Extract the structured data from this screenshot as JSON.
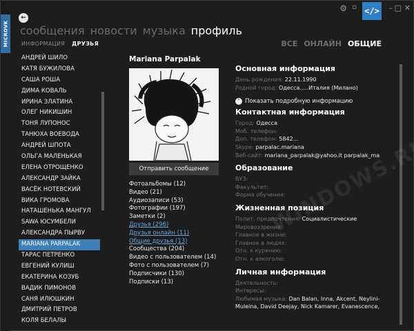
{
  "brand": {
    "label": "MICROVK"
  },
  "nav": {
    "items": [
      "сообщения",
      "новости",
      "музыка",
      "профиль"
    ]
  },
  "subnav": {
    "items": [
      "ИНФОРМАЦИЯ",
      "ДРУЗЬЯ"
    ]
  },
  "filters": {
    "items": [
      "ВСЕ",
      "ОНЛАЙН",
      "ОБЩИЕ"
    ]
  },
  "friends": [
    "АНДРЕЙ ШИЛО",
    "КАТЯ БУЖИЛОВА",
    "САША РОША",
    "ДИМА КОВАЛЬ",
    "ИРИНА ЗЛАТИНА",
    "ОЛЕГ НИКИШИН",
    "ТОНЯ ЛУПОНОС",
    "ТАНЮХА ВОЕВОДА",
    "АНДРЕЙ ШПОТА",
    "ОЛЬГА МАЛЕНЬКАЯ",
    "ЕЛЕНА ОТРОЩЕНКО",
    "АЛЕКСАНДР ЗАЙКА",
    "ВАСЁК НОТЕВСКИЙ",
    "ВИКА ГРОМОВА",
    "НАТАШЕНЬКА МАНГУЛ",
    "SAWA ЮСУМБЕЛИ",
    "АЛЕКСАНДРА ПЫРВУ",
    "MARIANA PARPALAK",
    "ТАРАС ПЕТРЕНКО",
    "ЕВГЕНИЙ КУЛИШ",
    "ЕКАТЕРИНА КОЗУБ",
    "ВАДИК ПИМОНОВ",
    "САНЯ ИЛЮШКИН",
    "ДМИТРИЙ ПЕТРОВ",
    "КОЛЯ БЕЛАЛЫ"
  ],
  "profile": {
    "name": "Mariana  Parpalak",
    "send_button": "Отправить сообщение",
    "links": [
      {
        "text": "Фотоальбомы (12)",
        "link": false
      },
      {
        "text": "Видео (21)",
        "link": false
      },
      {
        "text": "Аудиозаписи (53)",
        "link": false
      },
      {
        "text": "Фотографии (197)",
        "link": false
      },
      {
        "text": "Заметки (2)",
        "link": false
      },
      {
        "text": "Друзья (296)",
        "link": true
      },
      {
        "text": "Друзья онлайн (11)",
        "link": true
      },
      {
        "text": "Общие друзья (13)",
        "link": true
      },
      {
        "text": "Сообщества (204)",
        "link": false
      },
      {
        "text": "Видео с пользователем (14)",
        "link": false
      },
      {
        "text": "Фото с пользователем (7)",
        "link": false
      },
      {
        "text": "Подписчики (130)",
        "link": false
      },
      {
        "text": "Подписки (13)",
        "link": false
      }
    ]
  },
  "info": {
    "basic_title": "Основная информация",
    "basic": [
      {
        "k": "День рождения:",
        "v": "22.11.1990"
      },
      {
        "k": "Родной город:",
        "v": "Одесса.....Италия (Милано)"
      }
    ],
    "expand_label": "Показать подробную информацию",
    "contact_title": "Контактная информация",
    "contact": [
      {
        "k": "Город:",
        "v": "Одесса"
      },
      {
        "k": "Моб. телефон:",
        "v": ""
      },
      {
        "k": "Доп. телефон:",
        "v": "5842..."
      },
      {
        "k": "Skype:",
        "v": "parpalac.mariana"
      },
      {
        "k": "Веб-сайт:",
        "v": "mariana_parpalak@yahoo.it    parpalak_ma"
      }
    ],
    "edu_title": "Образование",
    "edu": [
      {
        "k": "ВУЗ:",
        "v": ""
      },
      {
        "k": "Факультет:",
        "v": ""
      },
      {
        "k": "Форма обучения:",
        "v": ""
      }
    ],
    "life_title": "Жизненная позиция",
    "life": [
      {
        "k": "Полит. предпочтения:",
        "v": "Социалистические"
      },
      {
        "k": "Мировоззрение:",
        "v": ""
      },
      {
        "k": "Главное в жизни:",
        "v": ""
      },
      {
        "k": "Главное в людях:",
        "v": ""
      },
      {
        "k": "Отн. к курению:",
        "v": ""
      },
      {
        "k": "Отн. к алкоголю:",
        "v": ""
      }
    ],
    "personal_title": "Личная информация",
    "personal": [
      {
        "k": "Деятельность:",
        "v": ""
      },
      {
        "k": "Интересы:",
        "v": ""
      }
    ],
    "music_key": "Любимая музыка:",
    "music_val": "Dan Balan, Inna, Akcent, Neylini-Muleina, David Deejay, Nick Kamarer, Evanescence,"
  },
  "watermark": "WINDOWS.RU"
}
